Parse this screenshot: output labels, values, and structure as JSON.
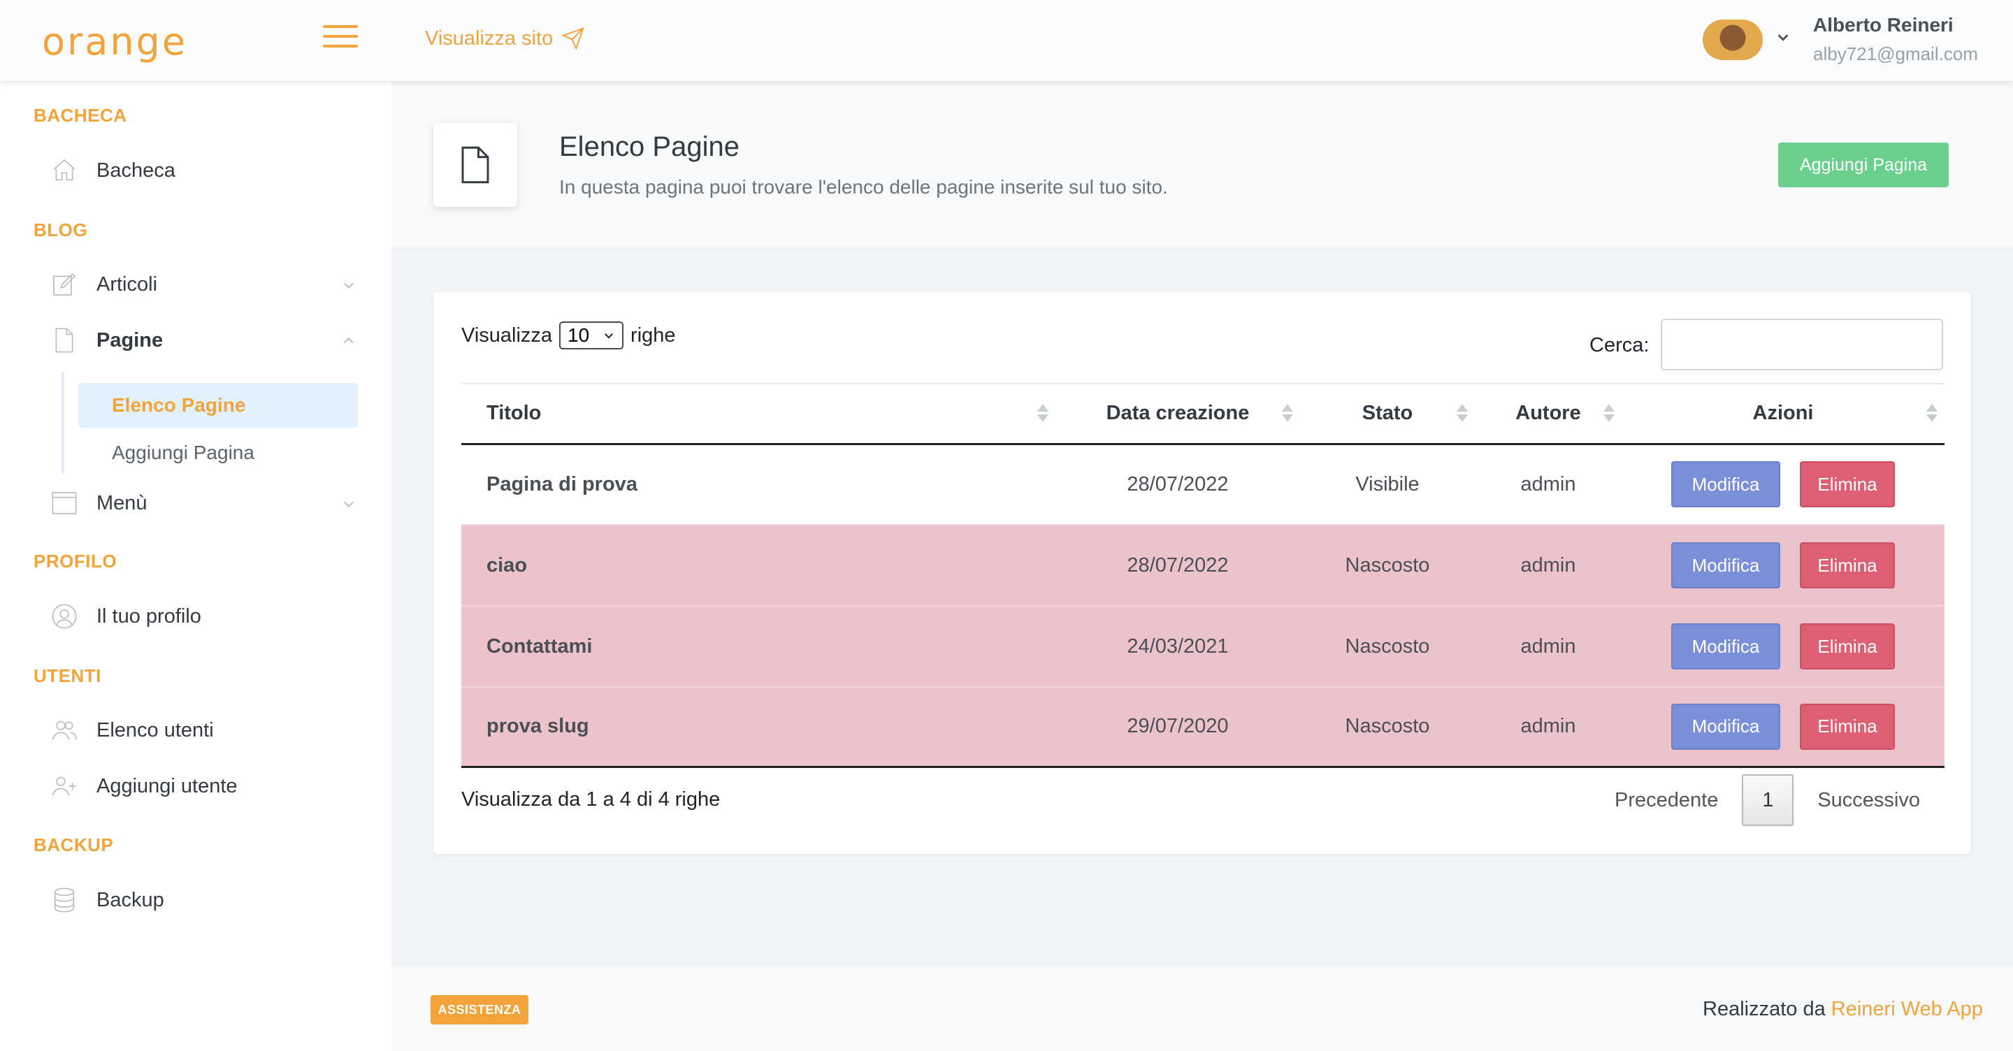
{
  "header": {
    "logo": "orange",
    "visit_site": "Visualizza sito",
    "user_name": "Alberto Reineri",
    "user_email": "alby721@gmail.com"
  },
  "sidebar": {
    "sections": {
      "dashboard": "BACHECA",
      "blog": "BLOG",
      "profile": "PROFILO",
      "users": "UTENTI",
      "backup": "BACKUP"
    },
    "items": {
      "dashboard": "Bacheca",
      "articles": "Articoli",
      "pages": "Pagine",
      "pages_list": "Elenco Pagine",
      "add_page": "Aggiungi Pagina",
      "menu": "Menù",
      "profile": "Il tuo profilo",
      "users_list": "Elenco utenti",
      "add_user": "Aggiungi utente",
      "backup": "Backup"
    }
  },
  "page": {
    "title": "Elenco Pagine",
    "subtitle": "In questa pagina puoi trovare l'elenco delle pagine inserite sul tuo sito.",
    "add_button": "Aggiungi Pagina"
  },
  "table_controls": {
    "show_prefix": "Visualizza",
    "page_size": "10",
    "show_suffix": "righe",
    "search_label": "Cerca:",
    "info": "Visualizza da 1 a 4 di 4 righe",
    "prev": "Precedente",
    "current_page": "1",
    "next": "Successivo"
  },
  "table": {
    "columns": [
      "Titolo",
      "Data creazione",
      "Stato",
      "Autore",
      "Azioni"
    ],
    "rows": [
      {
        "title": "Pagina di prova",
        "date": "28/07/2022",
        "status": "Visibile",
        "author": "admin",
        "edit": "Modifica",
        "delete": "Elimina"
      },
      {
        "title": "ciao",
        "date": "28/07/2022",
        "status": "Nascosto",
        "author": "admin",
        "edit": "Modifica",
        "delete": "Elimina"
      },
      {
        "title": "Contattami",
        "date": "24/03/2021",
        "status": "Nascosto",
        "author": "admin",
        "edit": "Modifica",
        "delete": "Elimina"
      },
      {
        "title": "prova slug",
        "date": "29/07/2020",
        "status": "Nascosto",
        "author": "admin",
        "edit": "Modifica",
        "delete": "Elimina"
      }
    ]
  },
  "footer": {
    "support_badge": "ASSISTENZA",
    "credit_prefix": "Realizzato da",
    "credit_link": "Reineri Web App"
  },
  "colors": {
    "accent": "#f2a33a",
    "success": "#6bd08e",
    "edit": "#7a8fd8",
    "delete": "#dd5f73",
    "hidden_row": "#edc3cb"
  }
}
